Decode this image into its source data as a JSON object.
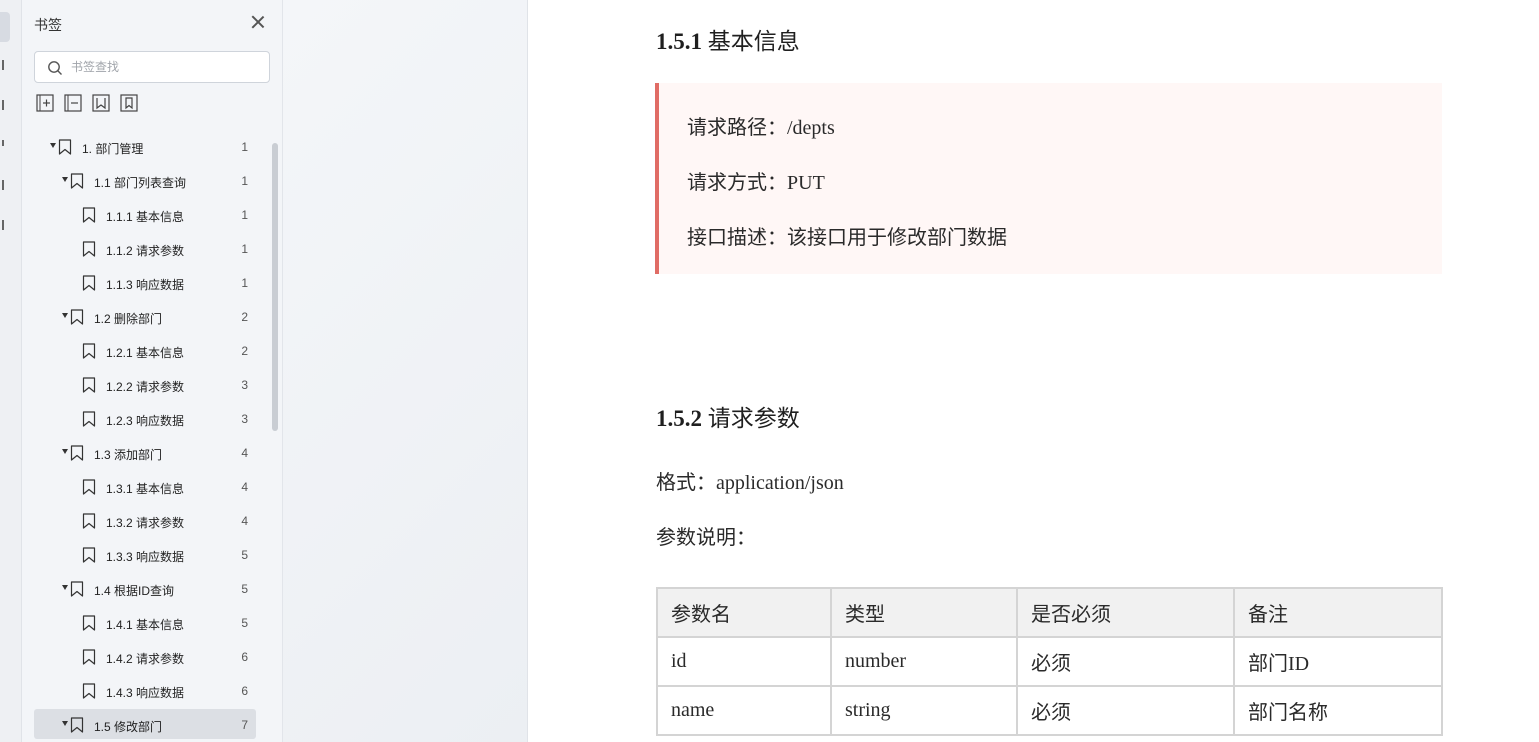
{
  "panel": {
    "title": "书签",
    "search_placeholder": "书签查找"
  },
  "bookmarks": [
    {
      "label": "1. 部门管理",
      "page": "1",
      "level": 0,
      "expanded": true
    },
    {
      "label": "1.1 部门列表查询",
      "page": "1",
      "level": 1,
      "expanded": true
    },
    {
      "label": "1.1.1 基本信息",
      "page": "1",
      "level": 2
    },
    {
      "label": "1.1.2 请求参数",
      "page": "1",
      "level": 2
    },
    {
      "label": "1.1.3 响应数据",
      "page": "1",
      "level": 2
    },
    {
      "label": "1.2 删除部门",
      "page": "2",
      "level": 1,
      "expanded": true
    },
    {
      "label": "1.2.1 基本信息",
      "page": "2",
      "level": 2
    },
    {
      "label": "1.2.2 请求参数",
      "page": "3",
      "level": 2
    },
    {
      "label": "1.2.3 响应数据",
      "page": "3",
      "level": 2
    },
    {
      "label": "1.3 添加部门",
      "page": "4",
      "level": 1,
      "expanded": true
    },
    {
      "label": "1.3.1 基本信息",
      "page": "4",
      "level": 2
    },
    {
      "label": "1.3.2 请求参数",
      "page": "4",
      "level": 2
    },
    {
      "label": "1.3.3 响应数据",
      "page": "5",
      "level": 2
    },
    {
      "label": "1.4 根据ID查询",
      "page": "5",
      "level": 1,
      "expanded": true
    },
    {
      "label": "1.4.1 基本信息",
      "page": "5",
      "level": 2
    },
    {
      "label": "1.4.2 请求参数",
      "page": "6",
      "level": 2
    },
    {
      "label": "1.4.3 响应数据",
      "page": "6",
      "level": 2
    },
    {
      "label": "1.5 修改部门",
      "page": "7",
      "level": 1,
      "expanded": true,
      "selected": true
    }
  ],
  "document": {
    "section1": {
      "num": "1.5.1",
      "title": "基本信息"
    },
    "callout": [
      "请求路径：/depts",
      "请求方式：PUT",
      "接口描述：该接口用于修改部门数据"
    ],
    "section2": {
      "num": "1.5.2",
      "title": "请求参数"
    },
    "format_line": "格式：application/json",
    "params_caption": "参数说明：",
    "table": {
      "headers": [
        "参数名",
        "类型",
        "是否必须",
        "备注"
      ],
      "rows": [
        [
          "id",
          "number",
          "必须",
          "部门ID"
        ],
        [
          "name",
          "string",
          "必须",
          "部门名称"
        ]
      ]
    }
  }
}
